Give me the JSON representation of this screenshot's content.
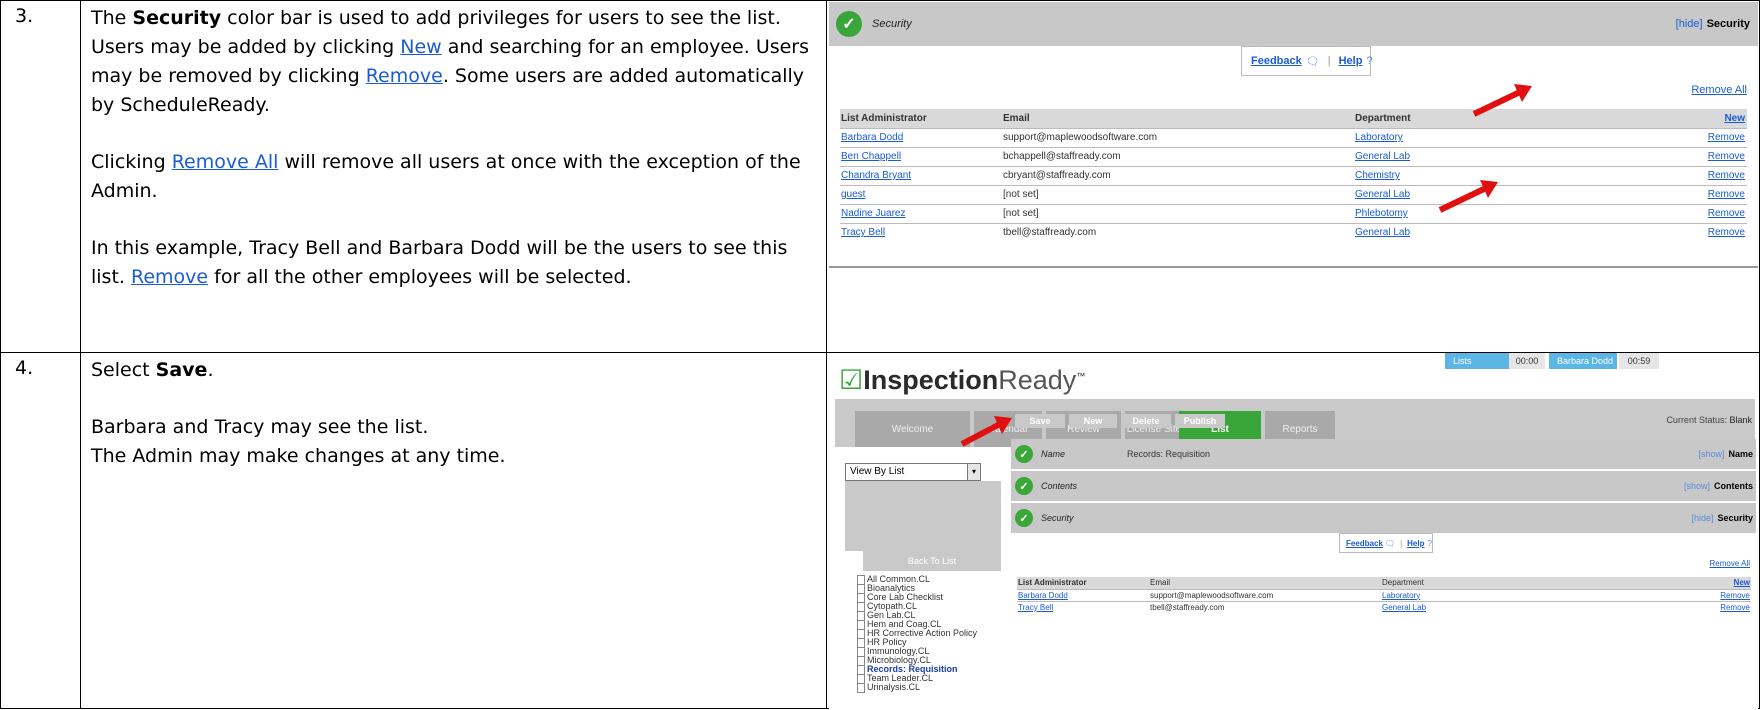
{
  "row3": {
    "number": "3.",
    "p1_a": "The ",
    "p1_bold": "Security",
    "p1_b": " color bar is used to add privileges for users to see the list.  Users may be added by clicking ",
    "p1_link_new": "New",
    "p1_c": " and searching for an employee.  Users may be removed by clicking ",
    "p1_link_remove": "Remove",
    "p1_d": ".  Some users are added automatically by ScheduleReady.",
    "p2_a": "Clicking ",
    "p2_link": "Remove All",
    "p2_b": " will remove all users at once with the exception of the Admin.",
    "p3_a": "In this example, Tracy Bell and Barbara Dodd will be the users to see this list.  ",
    "p3_link": "Remove",
    "p3_b": " for all the other employees will be selected."
  },
  "row4": {
    "number": "4.",
    "p1_a": "Select ",
    "p1_bold": "Save",
    "p1_b": ".",
    "p2_line1": "Barbara and Tracy may see the list.",
    "p2_line2": "The Admin may make changes at any time."
  },
  "shot1": {
    "bar_title": "Security",
    "bar_toggle": "[hide]",
    "bar_right": "Security",
    "feedback": "Feedback",
    "help": "Help",
    "help_q": "?",
    "separator": "|",
    "remove_all": "Remove All",
    "columns": [
      "List Administrator",
      "Email",
      "Department",
      "New"
    ],
    "rows": [
      {
        "name": "Barbara Dodd",
        "email": "support@maplewoodsoftware.com",
        "dept": "Laboratory",
        "action": "Remove"
      },
      {
        "name": "Ben Chappell",
        "email": "bchappell@staffready.com",
        "dept": "General Lab",
        "action": "Remove"
      },
      {
        "name": "Chandra Bryant",
        "email": "cbryant@staffready.com",
        "dept": "Chemistry",
        "action": "Remove"
      },
      {
        "name": "guest",
        "email": "[not set]",
        "dept": "General Lab",
        "action": "Remove"
      },
      {
        "name": "Nadine Juarez",
        "email": "[not set]",
        "dept": "Phlebotomy",
        "action": "Remove"
      },
      {
        "name": "Tracy Bell",
        "email": "tbell@staffready.com",
        "dept": "General Lab",
        "action": "Remove"
      }
    ]
  },
  "shot2": {
    "logo_box": "☑",
    "logo_main": "Inspection",
    "logo_ready": "Ready",
    "logo_tm": "™",
    "status_lists": "Lists",
    "status_time1": "00:00",
    "status_user": "Barbara Dodd",
    "status_time2": "00:59",
    "tabs": [
      "Welcome",
      "Calendar",
      "Review",
      "License Site",
      "List",
      "Reports"
    ],
    "active_tab": "List",
    "view_by": "View By List",
    "back_to_list": "Back To List",
    "lists": [
      "All Common.CL",
      "Bioanalytics",
      "Core Lab Checklist",
      "Cytopath.CL",
      "Gen Lab.CL",
      "Hem and Coag.CL",
      "HR Corrective Action Policy",
      "HR Policy",
      "Immunology.CL",
      "Microbiology.CL",
      "Records: Requisition",
      "Team Leader.CL",
      "Urinalysis.CL"
    ],
    "selected_list": "Records: Requisition",
    "actions": [
      "Save",
      "New",
      "Delete",
      "Publish"
    ],
    "current_status_label": "Current Status:",
    "current_status_value": "Blank",
    "bar_name": {
      "title": "Name",
      "mid": "Records: Requisition",
      "toggle": "[show]",
      "right": "Name"
    },
    "bar_contents": {
      "title": "Contents",
      "toggle": "[show]",
      "right": "Contents"
    },
    "bar_security": {
      "title": "Security",
      "toggle": "[hide]",
      "right": "Security"
    },
    "feedback": "Feedback",
    "help": "Help",
    "help_q": "?",
    "separator": "|",
    "remove_all": "Remove All",
    "columns": [
      "List Administrator",
      "Email",
      "Department",
      "New"
    ],
    "rows": [
      {
        "name": "Barbara Dodd",
        "email": "support@maplewoodsoftware.com",
        "dept": "Laboratory",
        "action": "Remove"
      },
      {
        "name": "Tracy Bell",
        "email": "tbell@staffready.com",
        "dept": "General Lab",
        "action": "Remove"
      }
    ]
  },
  "colors": {
    "accent_green": "#3aa63a",
    "link_blue": "#1a5bd6",
    "arrow_red": "#e01010",
    "bar_gray": "#c8c8c8"
  }
}
